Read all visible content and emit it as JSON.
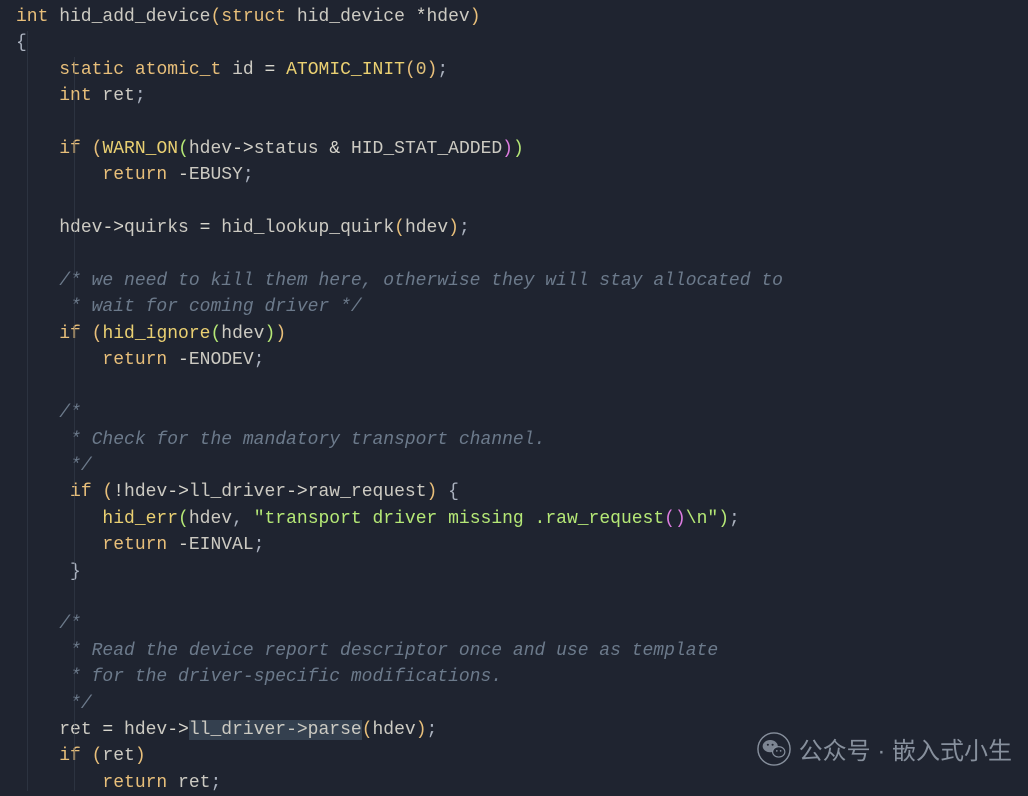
{
  "code": {
    "l1": {
      "a": "int",
      "b": " hid_add_device",
      "c": "(",
      "d": "struct",
      "e": " hid_device ",
      "f": "*",
      "g": "hdev",
      "h": ")"
    },
    "l2": "{",
    "l3": {
      "indent": "    ",
      "a": "static",
      "sp": " ",
      "b": "atomic_t",
      "c": " id ",
      "d": "=",
      "e": " ",
      "f": "ATOMIC_INIT",
      "g": "(",
      "h": "0",
      "i": ")",
      "j": ";"
    },
    "l4": {
      "indent": "    ",
      "a": "int",
      "b": " ret",
      "c": ";"
    },
    "l5": "",
    "l6": {
      "indent": "    ",
      "a": "if",
      "b": " (",
      "c": "WARN_ON",
      "d": "(",
      "e": "hdev",
      "f": "->",
      "g": "status ",
      "h": "&",
      "i": " HID_STAT_ADDED",
      "j": ")",
      ")": ")"
    },
    "l7": {
      "indent": "        ",
      "a": "return",
      "b": " -",
      "c": "EBUSY",
      "d": ";"
    },
    "l8": "",
    "l9": {
      "indent": "    ",
      "a": "hdev",
      "b": "->",
      "c": "quirks ",
      "d": "=",
      "e": " hid_lookup_quirk",
      "f": "(",
      "g": "hdev",
      "h": ")",
      "i": ";"
    },
    "l10": "",
    "l11": {
      "indent": "    ",
      "a": "/* we need to kill them here, otherwise they will stay allocated to"
    },
    "l12": {
      "indent": "     ",
      "a": "* wait for coming driver */"
    },
    "l13": {
      "indent": "    ",
      "a": "if",
      "b": " (",
      "c": "hid_ignore",
      "d": "(",
      "e": "hdev",
      "f": ")",
      "g": ")"
    },
    "l14": {
      "indent": "        ",
      "a": "return",
      "b": " -",
      "c": "ENODEV",
      "d": ";"
    },
    "l15": "",
    "l16": {
      "indent": "    ",
      "a": "/*"
    },
    "l17": {
      "indent": "     ",
      "a": "* Check for the mandatory transport channel."
    },
    "l18": {
      "indent": "     ",
      "a": "*/"
    },
    "l19": {
      "indent": "     ",
      "a": "if",
      "b": " (",
      "c": "!",
      "d": "hdev",
      "e": "->",
      "f": "ll_driver",
      "g": "->",
      "h": "raw_request",
      "i": ")",
      "j": " {"
    },
    "l20": {
      "indent": "        ",
      "a": "hid_err",
      "b": "(",
      "c": "hdev",
      "d": ", ",
      "e": "\"transport driver missing .raw_request",
      "f": "()",
      "g": "\\n",
      "h": "\"",
      "i": ")",
      "j": ";"
    },
    "l21": {
      "indent": "        ",
      "a": "return",
      "b": " -",
      "c": "EINVAL",
      "d": ";"
    },
    "l22": {
      "indent": "     ",
      "a": "}"
    },
    "l23": "",
    "l24": {
      "indent": "    ",
      "a": "/*"
    },
    "l25": {
      "indent": "     ",
      "a": "* Read the device report descriptor once and use as template"
    },
    "l26": {
      "indent": "     ",
      "a": "* for the driver-specific modifications."
    },
    "l27": {
      "indent": "     ",
      "a": "*/"
    },
    "l28": {
      "indent": "    ",
      "a": "ret",
      "b": " = ",
      "c": "hdev",
      "d": "->",
      "e": "ll_driver->parse",
      "f": "(",
      "g": "hdev",
      "h": ")",
      "i": ";"
    },
    "l29": {
      "indent": "    ",
      "a": "if",
      "b": " (",
      "c": "ret",
      "d": ")"
    },
    "l30": {
      "indent": "        ",
      "a": "return",
      "b": " ",
      "c": "ret",
      "d": ";"
    }
  },
  "watermark": "公众号 · 嵌入式小生"
}
